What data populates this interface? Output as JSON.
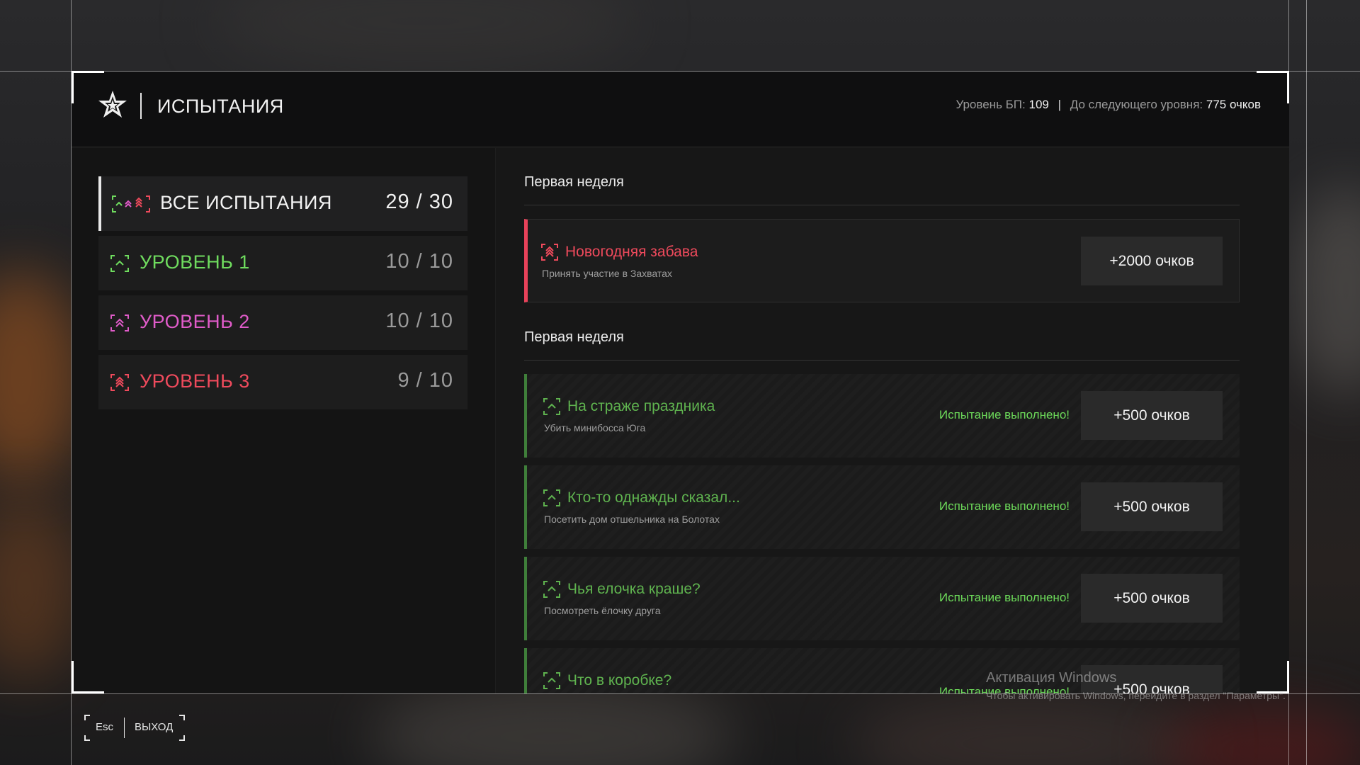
{
  "header": {
    "title": "ИСПЫТАНИЯ",
    "bp_level_label": "Уровень БП:",
    "bp_level_value": "109",
    "separator": "|",
    "next_level_label": "До следующего уровня:",
    "next_level_value": "775 очков"
  },
  "categories": [
    {
      "label": "ВСЕ ИСПЫТАНИЯ",
      "count": "29 / 30",
      "color": "#f3f3f3",
      "icon": "all-tiers-icon"
    },
    {
      "label": "УРОВЕНЬ 1",
      "count": "10 / 10",
      "color": "#6fdc5e",
      "icon": "tier-1-chevron-icon"
    },
    {
      "label": "УРОВЕНЬ 2",
      "count": "10 / 10",
      "color": "#e05bc9",
      "icon": "tier-2-chevron-icon"
    },
    {
      "label": "УРОВЕНЬ 3",
      "count": "9 / 10",
      "color": "#ef4a5c",
      "icon": "tier-3-chevron-icon"
    }
  ],
  "sections": [
    {
      "title": "Первая неделя"
    },
    {
      "title": "Первая неделя"
    }
  ],
  "featured": {
    "title": "Новогодняя забава",
    "desc": "Принять участие в Захватах",
    "reward": "+2000 очков",
    "color": "#ef4a5c"
  },
  "challenges": [
    {
      "title": "На страже праздника",
      "desc": "Убить минибосса Юга",
      "status": "Испытание выполнено!",
      "reward": "+500 очков"
    },
    {
      "title": "Кто-то однажды сказал...",
      "desc": "Посетить дом отшельника на Болотах",
      "status": "Испытание выполнено!",
      "reward": "+500 очков"
    },
    {
      "title": "Чья елочка краше?",
      "desc": "Посмотреть ёлочку друга",
      "status": "Испытание выполнено!",
      "reward": "+500 очков"
    },
    {
      "title": "Что в коробке?",
      "desc": "",
      "status": "Испытание выполнено!",
      "reward": "+500 очков"
    }
  ],
  "colors": {
    "done_green": "#6ddb5a",
    "done_title": "#5fb34f",
    "accent_red": "#ef4a5c"
  },
  "footer": {
    "key": "Esc",
    "label": "ВЫХОД"
  },
  "watermark": {
    "title": "Активация Windows",
    "subtitle": "Чтобы активировать Windows, перейдите в раздел \"Параметры\"."
  }
}
